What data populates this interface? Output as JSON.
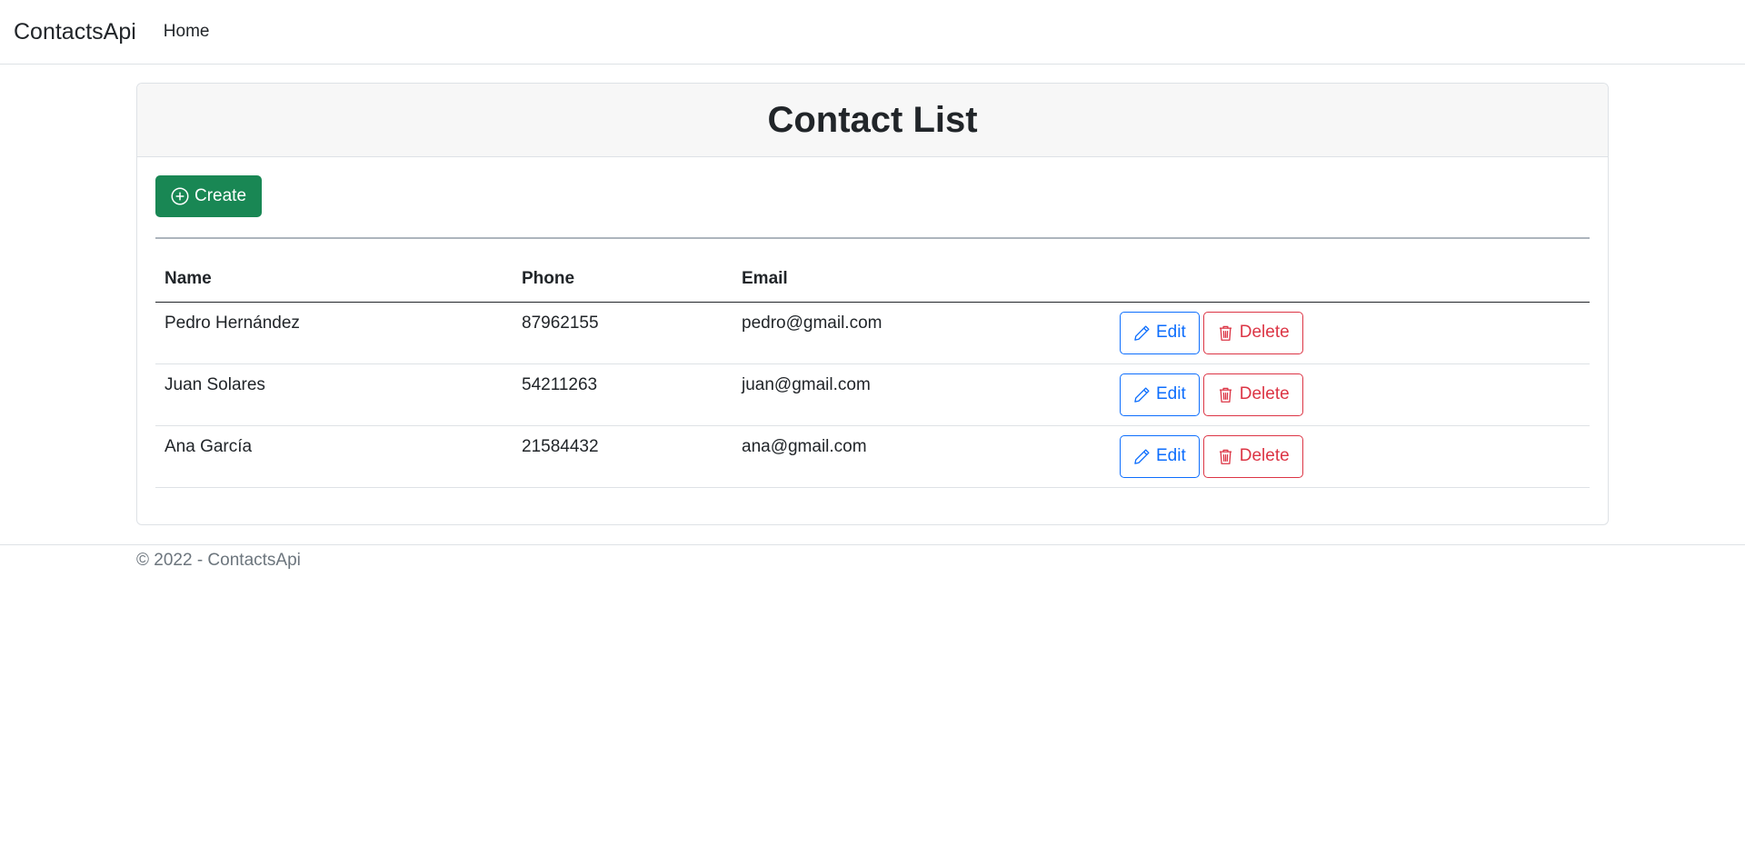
{
  "nav": {
    "brand": "ContactsApi",
    "home_label": "Home"
  },
  "card": {
    "title": "Contact List",
    "create_label": "Create"
  },
  "table": {
    "headers": [
      "Name",
      "Phone",
      "Email",
      ""
    ],
    "rows": [
      {
        "name": "Pedro Hernández",
        "phone": "87962155",
        "email": "pedro@gmail.com"
      },
      {
        "name": "Juan Solares",
        "phone": "54211263",
        "email": "juan@gmail.com"
      },
      {
        "name": "Ana García",
        "phone": "21584432",
        "email": "ana@gmail.com"
      }
    ],
    "edit_label": "Edit",
    "delete_label": "Delete"
  },
  "footer": {
    "text": "© 2022 - ContactsApi"
  },
  "icons": {
    "create": "plus-circle-icon",
    "edit": "pencil-icon",
    "delete": "trash-icon"
  },
  "colors": {
    "success": "#198754",
    "primary": "#0d6efd",
    "danger": "#dc3545",
    "muted": "#6c757d"
  }
}
